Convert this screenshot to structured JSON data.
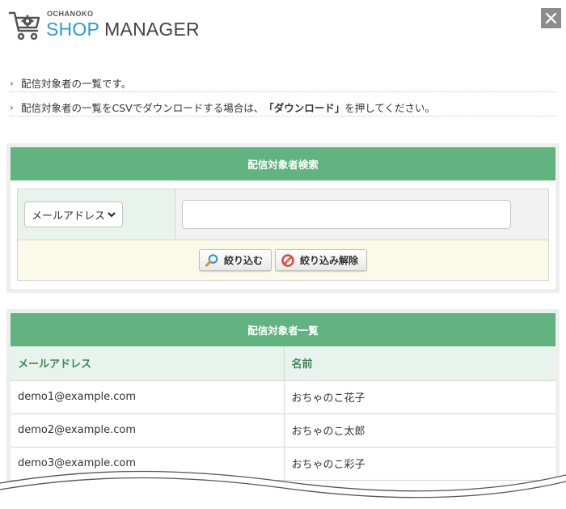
{
  "header": {
    "logo_small": "OCHANOKO",
    "logo_shop": "SHOP",
    "logo_manager": "MANAGER",
    "close_icon": "close-icon"
  },
  "notes": [
    "配信対象者の一覧です。",
    "配信対象者の一覧をCSVでダウンロードする場合は、",
    "「ダウンロード」",
    "を押してください。"
  ],
  "search": {
    "title": "配信対象者検索",
    "field_selected": "メールアドレス",
    "input_value": "",
    "filter_label": "絞り込む",
    "clear_label": "絞り込み解除"
  },
  "list": {
    "title": "配信対象者一覧",
    "columns": [
      "メールアドレス",
      "名前"
    ],
    "rows": [
      [
        "demo1@example.com",
        "おちゃのこ花子"
      ],
      [
        "demo2@example.com",
        "おちゃのこ太郎"
      ],
      [
        "demo3@example.com",
        "おちゃのこ彩子"
      ]
    ]
  },
  "colors": {
    "accent": "#62b37f",
    "header_text": "#3c8a57",
    "logo_blue": "#2c9ad0"
  }
}
